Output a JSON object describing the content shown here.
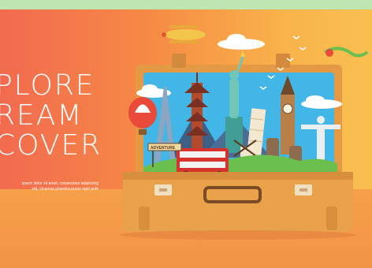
{
  "headline": {
    "line1": "PLORE",
    "line2": "REAM",
    "line3": "COVER"
  },
  "body_text": {
    "line1": "ipsum dolor sit amet, consectetur adipiscing",
    "line2": "elit. Vivamus pharetra purus eget ante"
  },
  "sign_text": "ADVENTURE",
  "colors": {
    "background_left": "#f26a4f",
    "background_right": "#f9c050",
    "suitcase": "#e9a14a",
    "sky": "#42b6e6"
  }
}
